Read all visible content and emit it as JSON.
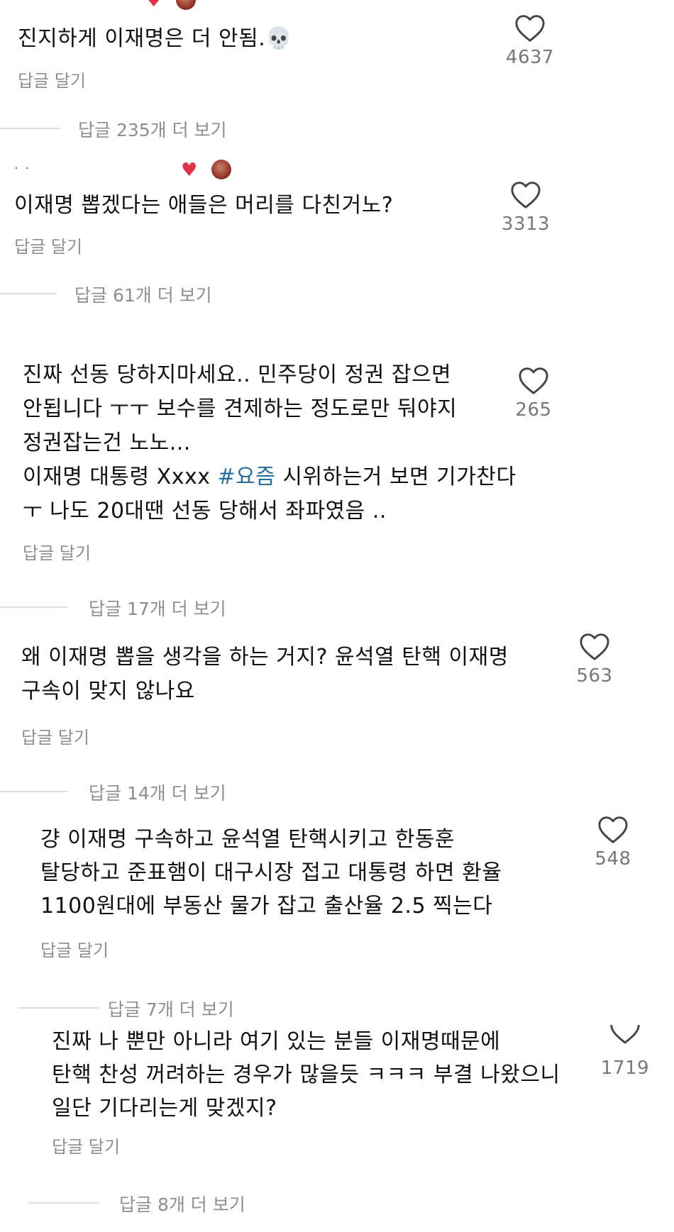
{
  "comments": [
    {
      "text": "진지하게 이재명은 더 안됨.💀",
      "reply_label": "답글 달기",
      "like_count": "4637",
      "more_replies": "답글 235개 더 보기"
    },
    {
      "text": "이재명 뽑겠다는 애들은 머리를 다친거노?",
      "reply_label": "답글 달기",
      "like_count": "3313",
      "more_replies": "답글 61개 더 보기"
    },
    {
      "text_parts": [
        "진짜 선동 당하지마세요.. 민주당이 정권 잡으면\n안됩니다 ㅜㅜ 보수를 견제하는 정도로만 둬야지\n정권잡는건 노노...\n이재명 대통령 Xxxx ",
        "#요즘",
        " 시위하는거 보면 기가찬다\nㅜ 나도 20대땐 선동 당해서 좌파였음 .."
      ],
      "reply_label": "답글 달기",
      "like_count": "265",
      "more_replies": "답글 17개 더 보기"
    },
    {
      "text": "왜 이재명 뽑을 생각을 하는 거지? 윤석열 탄핵 이재명\n구속이 맞지 않나요",
      "reply_label": "답글 달기",
      "like_count": "563",
      "more_replies": "답글 14개 더 보기"
    },
    {
      "text": "걍 이재명 구속하고 윤석열 탄핵시키고 한동훈\n탈당하고 준표햄이 대구시장 접고 대통령 하면 환율\n1100원대에 부동산 물가 잡고 출산율 2.5 찍는다",
      "reply_label": "답글 달기",
      "like_count": "548",
      "more_replies": "답글 7개 더 보기"
    },
    {
      "text": "진짜 나 뿐만 아니라 여기 있는 분들 이재명때문에\n탄핵 찬성 꺼려하는 경우가 많을듯 ㅋㅋㅋ 부결 나왔으니\n일단 기다리는게 맞겠지?",
      "reply_label": "답글 달기",
      "like_count": "1719",
      "more_replies": "답글 8개 더 보기"
    }
  ],
  "icons": {
    "like": "heart-outline-icon",
    "badge_heart": "red-heart-icon",
    "avatar": "author-avatar"
  },
  "colors": {
    "hashtag": "#2a6f9b",
    "muted": "#8e8e8e",
    "heart_red": "#e0334a"
  }
}
